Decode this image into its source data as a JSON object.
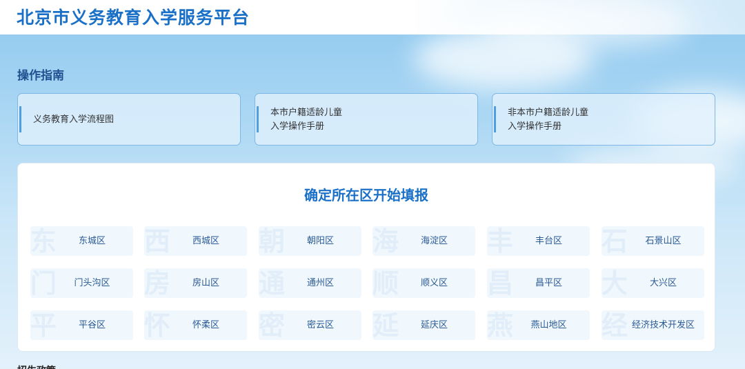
{
  "header": {
    "title": "北京市义务教育入学服务平台"
  },
  "guide": {
    "title": "操作指南",
    "cards": [
      {
        "line1": "义务教育入学流程图",
        "line2": ""
      },
      {
        "line1": "本市户籍适龄儿童",
        "line2": "入学操作手册"
      },
      {
        "line1": "非本市户籍适龄儿童",
        "line2": "入学操作手册"
      }
    ]
  },
  "districts": {
    "title": "确定所在区开始填报",
    "items": [
      {
        "label": "东城区",
        "watermark": "东"
      },
      {
        "label": "西城区",
        "watermark": "西"
      },
      {
        "label": "朝阳区",
        "watermark": "朝"
      },
      {
        "label": "海淀区",
        "watermark": "海"
      },
      {
        "label": "丰台区",
        "watermark": "丰"
      },
      {
        "label": "石景山区",
        "watermark": "石"
      },
      {
        "label": "门头沟区",
        "watermark": "门"
      },
      {
        "label": "房山区",
        "watermark": "房"
      },
      {
        "label": "通州区",
        "watermark": "通"
      },
      {
        "label": "顺义区",
        "watermark": "顺"
      },
      {
        "label": "昌平区",
        "watermark": "昌"
      },
      {
        "label": "大兴区",
        "watermark": "大"
      },
      {
        "label": "平谷区",
        "watermark": "平"
      },
      {
        "label": "怀柔区",
        "watermark": "怀"
      },
      {
        "label": "密云区",
        "watermark": "密"
      },
      {
        "label": "延庆区",
        "watermark": "延"
      },
      {
        "label": "燕山地区",
        "watermark": "燕"
      },
      {
        "label": "经济技术开发区",
        "watermark": "经"
      }
    ]
  },
  "policy": {
    "title": "招生政策"
  },
  "colors": {
    "brand": "#1a70c7",
    "card_border": "#7cb7e8",
    "district_bg": "#f0f7fd"
  }
}
